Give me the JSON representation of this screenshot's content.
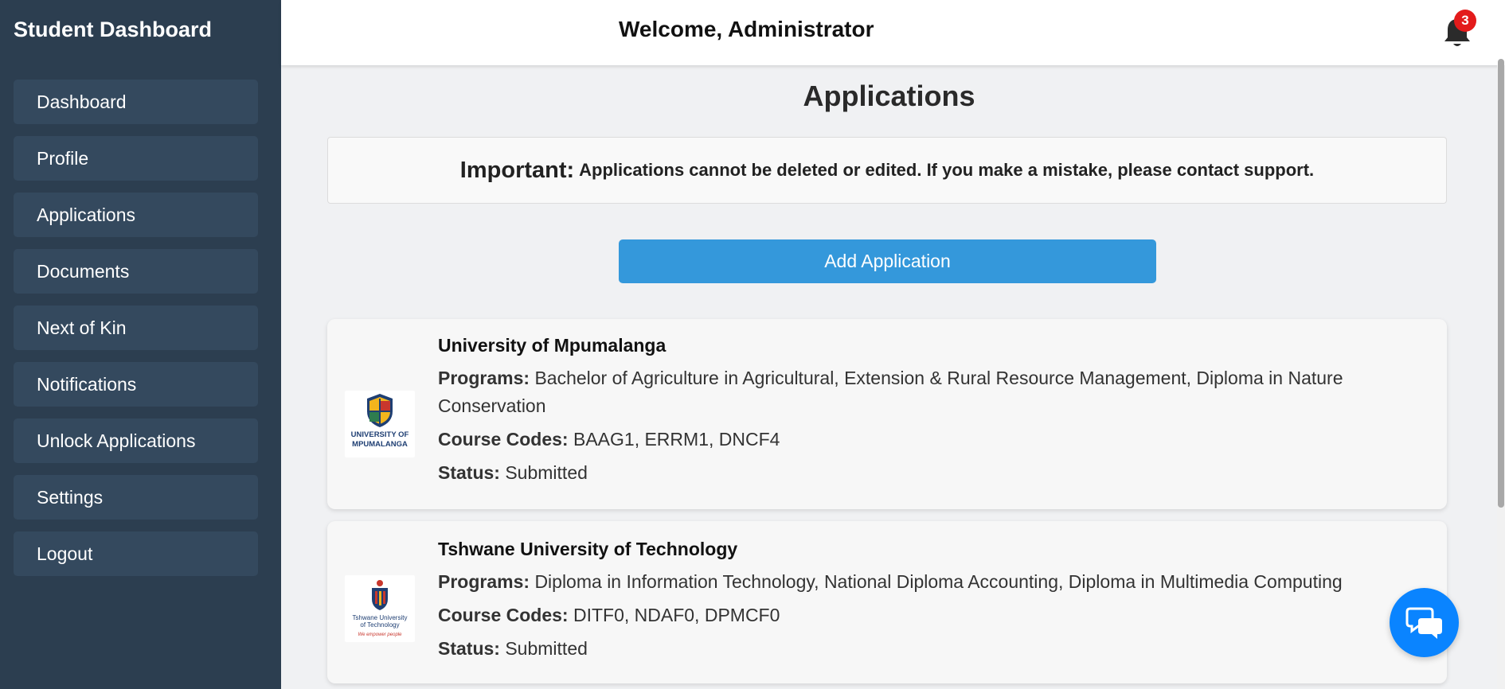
{
  "sidebar": {
    "title": "Student Dashboard",
    "items": [
      {
        "label": "Dashboard"
      },
      {
        "label": "Profile"
      },
      {
        "label": "Applications"
      },
      {
        "label": "Documents"
      },
      {
        "label": "Next of Kin"
      },
      {
        "label": "Notifications"
      },
      {
        "label": "Unlock Applications"
      },
      {
        "label": "Settings"
      },
      {
        "label": "Logout"
      }
    ]
  },
  "header": {
    "welcome": "Welcome, Administrator",
    "notification_count": "3",
    "bell_icon": "bell-icon"
  },
  "main": {
    "title": "Applications",
    "notice": {
      "strong": "Important:",
      "text": "Applications cannot be deleted or edited. If you make a mistake, please contact support."
    },
    "add_button": "Add Application",
    "labels": {
      "programs": "Programs:",
      "course_codes": "Course Codes:",
      "status": "Status:"
    },
    "applications": [
      {
        "university": "University of Mpumalanga",
        "logo_text": "UNIVERSITY OF MPUMALANGA",
        "programs": "Bachelor of Agriculture in Agricultural, Extension & Rural Resource Management, Diploma in Nature Conservation",
        "course_codes": "BAAG1, ERRM1, DNCF4",
        "status": "Submitted"
      },
      {
        "university": "Tshwane University of Technology",
        "logo_text": "Tshwane University of Technology",
        "logo_tagline": "We empower people",
        "programs": "Diploma in Information Technology, National Diploma Accounting, Diploma in Multimedia Computing",
        "course_codes": "DITF0, NDAF0, DPMCF0",
        "status": "Submitted"
      }
    ]
  },
  "colors": {
    "sidebar_bg": "#2c3e50",
    "nav_item_bg": "#34495e",
    "primary_button": "#3498db",
    "chat_button": "#0a84ff",
    "badge": "#e31b1b"
  },
  "chat": {
    "icon": "chat-bubbles-icon"
  }
}
